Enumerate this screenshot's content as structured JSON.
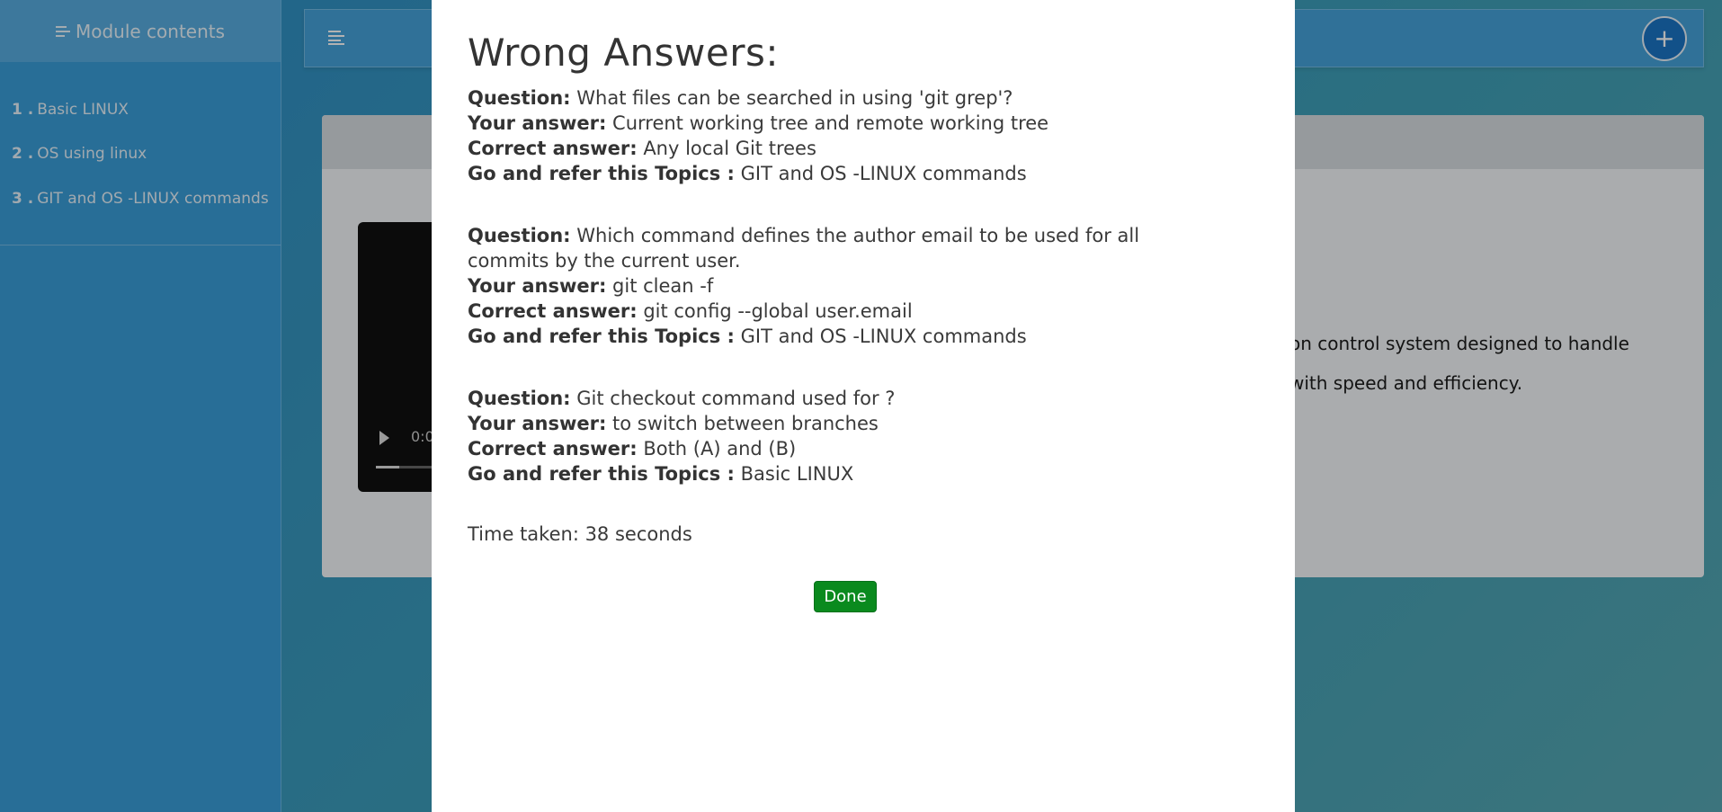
{
  "sidebar": {
    "title": "Module contents",
    "items": [
      {
        "num": "1 .",
        "label": "Basic LINUX"
      },
      {
        "num": "2 .",
        "label": "OS using linux"
      },
      {
        "num": "3 .",
        "label": "GIT and OS -LINUX commands"
      }
    ]
  },
  "topbar": {
    "add_label": "+"
  },
  "content": {
    "text_line1": "on control system designed to handle",
    "text_line2": "with speed and efficiency.",
    "video_time": "0:0"
  },
  "modal": {
    "title": "Wrong Answers:",
    "labels": {
      "question": "Question:",
      "your_answer": "Your answer:",
      "correct_answer": "Correct answer:",
      "refer": "Go and refer this Topics :"
    },
    "answers": [
      {
        "question": "What files can be searched in using 'git grep'?",
        "your_answer": "Current working tree and remote working tree",
        "correct_answer": "Any local Git trees",
        "topic": "GIT and OS -LINUX commands"
      },
      {
        "question": "Which command defines the author email to be used for all commits by the current user.",
        "your_answer": "git clean -f",
        "correct_answer": "git config --global user.email",
        "topic": "GIT and OS -LINUX commands"
      },
      {
        "question": "Git checkout command used for ?",
        "your_answer": "to switch between branches",
        "correct_answer": "Both (A) and (B)",
        "topic": "Basic LINUX"
      }
    ],
    "time_taken": "Time taken: 38 seconds",
    "done_label": "Done"
  }
}
